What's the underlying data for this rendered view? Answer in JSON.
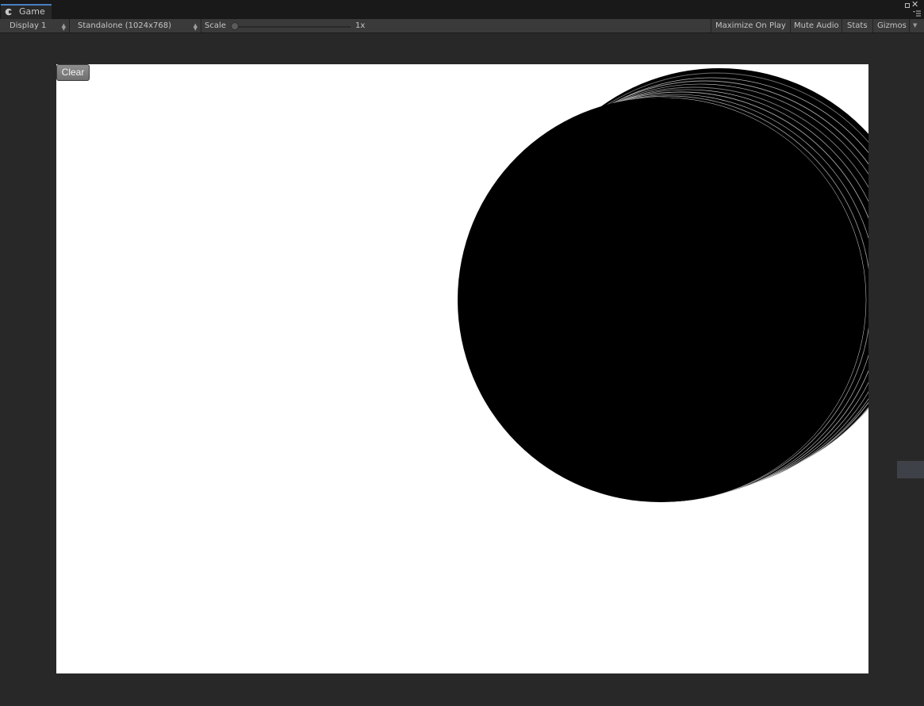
{
  "tab": {
    "label": "Game"
  },
  "toolbar": {
    "display": "Display 1",
    "resolution": "Standalone (1024x768)",
    "scale_label": "Scale",
    "scale_value": "1x",
    "maximize_on_play": "Maximize On Play",
    "mute_audio": "Mute Audio",
    "stats": "Stats",
    "gizmos": "Gizmos"
  },
  "game": {
    "clear_label": "Clear"
  },
  "icons": {
    "tab": "unity-game-icon",
    "maximize": "maximize-icon",
    "close": "close-icon",
    "menu": "menu-icon"
  },
  "colors": {
    "editor_bg": "#282828",
    "tab_accent": "#4a7fc1",
    "viewport_bg": "#ffffff",
    "shape": "#000000"
  }
}
